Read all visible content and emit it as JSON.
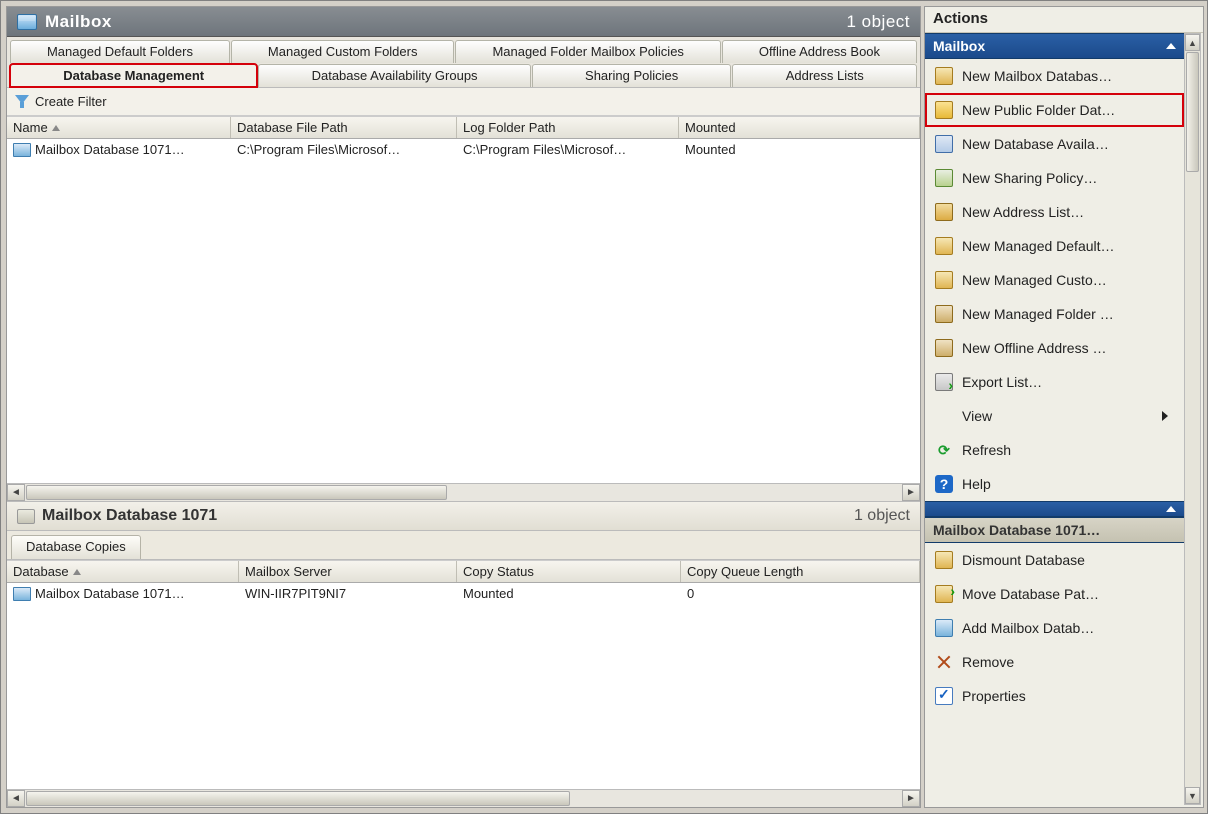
{
  "titlebar": {
    "title": "Mailbox",
    "count": "1 object"
  },
  "tabs_row1": [
    {
      "label": "Managed Default Folders"
    },
    {
      "label": "Managed Custom Folders"
    },
    {
      "label": "Managed Folder Mailbox Policies"
    },
    {
      "label": "Offline Address Book"
    }
  ],
  "tabs_row2": [
    {
      "label": "Database Management",
      "active": true,
      "highlight": true
    },
    {
      "label": "Database Availability Groups"
    },
    {
      "label": "Sharing Policies"
    },
    {
      "label": "Address Lists"
    }
  ],
  "filter": {
    "label": "Create Filter"
  },
  "top_grid": {
    "columns": [
      "Name",
      "Database File Path",
      "Log Folder Path",
      "Mounted"
    ],
    "rows": [
      {
        "name": "Mailbox Database 1071…",
        "path": "C:\\Program Files\\Microsof…",
        "log": "C:\\Program Files\\Microsof…",
        "mounted": "Mounted"
      }
    ]
  },
  "sub_panel": {
    "title": "Mailbox Database 1071",
    "count": "1 object",
    "tab": "Database Copies"
  },
  "bottom_grid": {
    "columns": [
      "Database",
      "Mailbox Server",
      "Copy Status",
      "Copy Queue Length"
    ],
    "rows": [
      {
        "database": "Mailbox Database 1071…",
        "server": "WIN-IIR7PIT9NI7",
        "status": "Mounted",
        "queue": "0"
      }
    ]
  },
  "actions": {
    "title": "Actions",
    "section1": "Mailbox",
    "items1": [
      {
        "label": "New Mailbox Databas…",
        "icon": "db"
      },
      {
        "label": "New Public Folder Dat…",
        "icon": "folder",
        "highlight": true
      },
      {
        "label": "New Database Availa…",
        "icon": "avail"
      },
      {
        "label": "New Sharing Policy…",
        "icon": "share"
      },
      {
        "label": "New Address List…",
        "icon": "addr"
      },
      {
        "label": "New Managed Default…",
        "icon": "db"
      },
      {
        "label": "New Managed Custo…",
        "icon": "db"
      },
      {
        "label": "New Managed Folder …",
        "icon": "book"
      },
      {
        "label": "New Offline Address …",
        "icon": "book"
      },
      {
        "label": "Export List…",
        "icon": "export"
      },
      {
        "label": "View",
        "icon": "",
        "submenu": true
      },
      {
        "label": "Refresh",
        "icon": "refresh",
        "glyph": "⟳"
      },
      {
        "label": "Help",
        "icon": "help",
        "glyph": "?"
      }
    ],
    "section2": "Mailbox Database 1071…",
    "items2": [
      {
        "label": "Dismount Database",
        "icon": "dismount"
      },
      {
        "label": "Move Database Pat…",
        "icon": "move"
      },
      {
        "label": "Add Mailbox Datab…",
        "icon": "add"
      },
      {
        "label": "Remove",
        "icon": "remove"
      },
      {
        "label": "Properties",
        "icon": "props"
      }
    ]
  }
}
